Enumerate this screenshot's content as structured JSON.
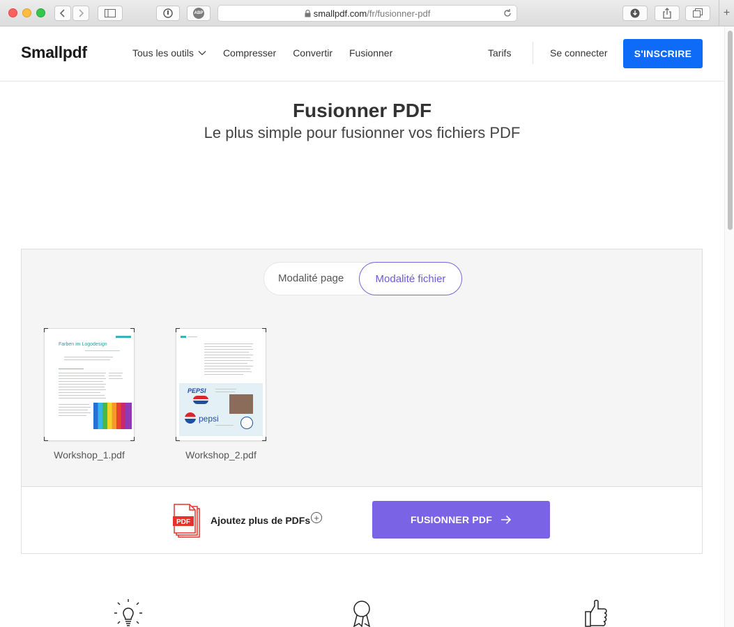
{
  "browser": {
    "url_domain": "smallpdf.com",
    "url_path": "/fr/fusionner-pdf",
    "adblock_label": "ABP"
  },
  "header": {
    "logo": "Smallpdf",
    "nav": [
      "Tous les outils",
      "Compresser",
      "Convertir",
      "Fusionner"
    ],
    "pricing": "Tarifs",
    "login": "Se connecter",
    "signup": "S'INSCRIRE"
  },
  "hero": {
    "title": "Fusionner PDF",
    "subtitle": "Le plus simple pour fusionner vos fichiers PDF"
  },
  "tool": {
    "mode_options": [
      "Modalité page",
      "Modalité fichier"
    ],
    "selected_mode": "Modalité fichier",
    "files": [
      {
        "name": "Workshop_1.pdf",
        "doc_title": "Farben im Logodesign"
      },
      {
        "name": "Workshop_2.pdf",
        "doc_title": ""
      }
    ],
    "add_more": "Ajoutez plus de PDFs",
    "merge_button": "FUSIONNER PDF",
    "pdf_icon_label": "PDF"
  },
  "colors": {
    "brand_blue": "#0e6bf8",
    "merge_purple": "#7b63e5",
    "pdf_red": "#e5322d"
  },
  "features_icons": [
    "lightbulb-icon",
    "award-ribbon-icon",
    "thumbs-up-icon"
  ]
}
